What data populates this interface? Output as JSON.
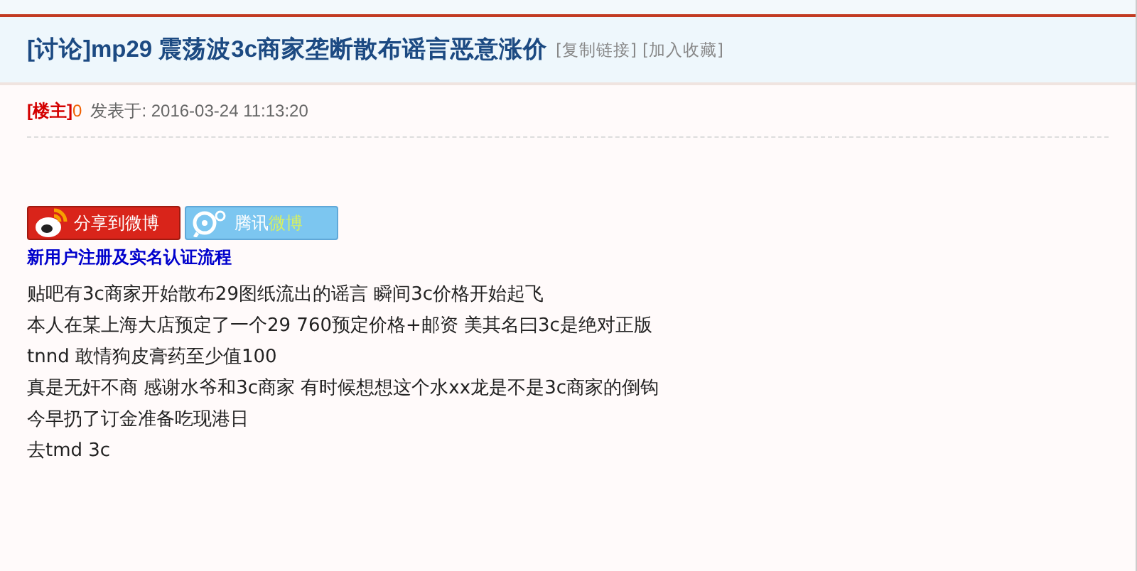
{
  "thread": {
    "title": "[讨论]mp29 震荡波3c商家垄断散布谣言恶意涨价",
    "links": [
      "[复制链接]",
      "[加入收藏]"
    ]
  },
  "post": {
    "role": "[楼主]",
    "author": "0",
    "posted": "发表于: 2016-03-24 11:13:20",
    "share_buttons": [
      {
        "kind": "weibo",
        "label": "分享到微博"
      },
      {
        "kind": "tencent",
        "label": "腾讯",
        "label_accent": "微博"
      }
    ],
    "register_link": "新用户注册及实名认证流程",
    "lines": [
      "贴吧有3c商家开始散布29图纸流出的谣言 瞬间3c价格开始起飞",
      "本人在某上海大店预定了一个29 760预定价格+邮资 美其名曰3c是绝对正版",
      "tnnd 敢情狗皮膏药至少值100",
      "真是无奸不商 感谢水爷和3c商家 有时候想想这个水xx龙是不是3c商家的倒钩",
      "今早扔了订金准备吃现港日",
      "去tmd 3c"
    ]
  }
}
